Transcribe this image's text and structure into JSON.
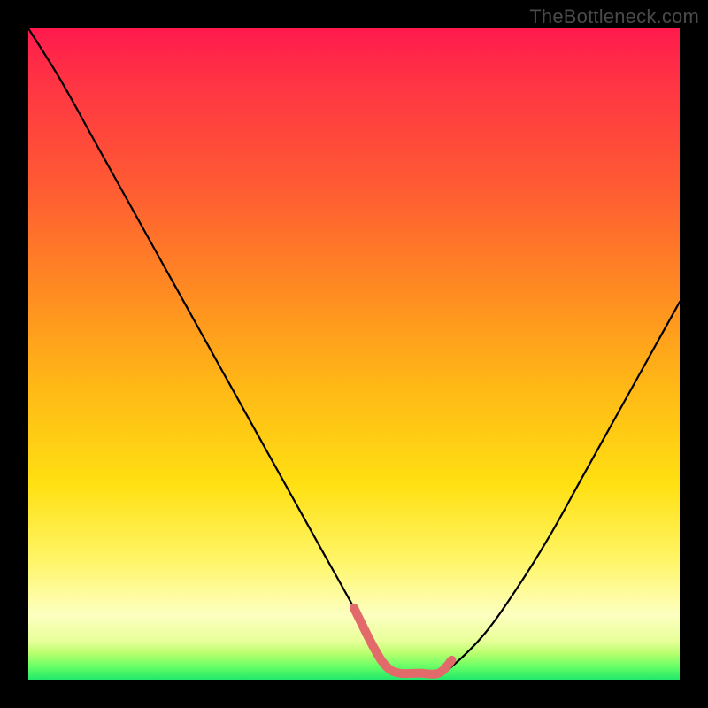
{
  "watermark": "TheBottleneck.com",
  "colors": {
    "curve": "#000000",
    "highlight": "#e26a6a",
    "frame_bg": "#000000"
  },
  "chart_data": {
    "type": "line",
    "title": "",
    "xlabel": "",
    "ylabel": "",
    "xlim": [
      0,
      100
    ],
    "ylim": [
      0,
      100
    ],
    "grid": false,
    "legend": false,
    "annotations": [],
    "series": [
      {
        "name": "bottleneck-curve",
        "x": [
          0,
          5,
          10,
          15,
          20,
          25,
          30,
          35,
          40,
          45,
          50,
          53,
          55,
          57,
          60,
          63,
          65,
          70,
          75,
          80,
          85,
          90,
          95,
          100
        ],
        "y": [
          100,
          92,
          83,
          74,
          65,
          56,
          47,
          38,
          29,
          20,
          11,
          5,
          2,
          1,
          1,
          1,
          2,
          7,
          14,
          22,
          31,
          40,
          49,
          58
        ]
      },
      {
        "name": "optimal-segment",
        "x": [
          50,
          53,
          55,
          57,
          60,
          63,
          65
        ],
        "y": [
          11,
          5,
          2,
          1,
          1,
          1,
          3
        ]
      }
    ]
  }
}
